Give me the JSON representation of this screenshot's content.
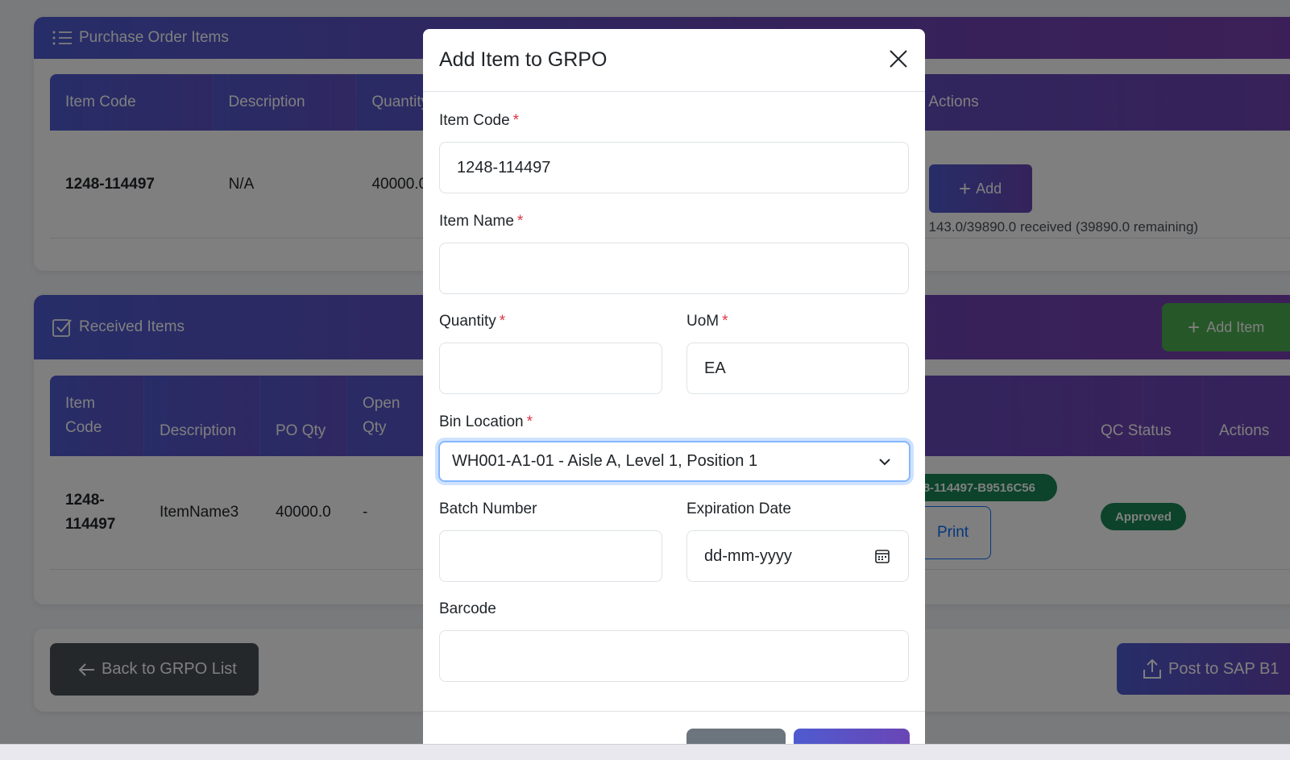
{
  "po_card": {
    "title": "Purchase Order Items",
    "headers": [
      "Item Code",
      "Description",
      "Quantity",
      "Actions"
    ],
    "row": {
      "item_code": "1248-114497",
      "description": "N/A",
      "quantity": "40000.0",
      "add_label": "Add",
      "received_text": "143.0/39890.0 received (39890.0 remaining)"
    }
  },
  "received_card": {
    "title": "Received Items",
    "add_item_label": "Add Item",
    "headers": [
      "Item Code",
      "Description",
      "PO Qty",
      "Open Qty",
      "QC Status",
      "Actions"
    ],
    "header_item_code_line1": "Item",
    "header_item_code_line2": "Code",
    "header_open_qty_line1": "Open",
    "header_open_qty_line2": "Qty",
    "row": {
      "item_code_line1": "1248-",
      "item_code_line2": "114497",
      "description": "ItemName3",
      "po_qty": "40000.0",
      "open_qty": "-",
      "batch_badge": "248-114497-B9516C56",
      "print_label": "Print",
      "qc_status": "Approved"
    }
  },
  "footer": {
    "back_label": "Back to GRPO List",
    "post_label": "Post to SAP B1"
  },
  "modal": {
    "title": "Add Item to GRPO",
    "fields": {
      "item_code": {
        "label": "Item Code",
        "value": "1248-114497"
      },
      "item_name": {
        "label": "Item Name",
        "value": ""
      },
      "quantity": {
        "label": "Quantity",
        "value": ""
      },
      "uom": {
        "label": "UoM",
        "value": "EA"
      },
      "bin_location": {
        "label": "Bin Location",
        "value": "WH001-A1-01 - Aisle A, Level 1, Position 1"
      },
      "batch_number": {
        "label": "Batch Number",
        "value": ""
      },
      "expiration_date": {
        "label": "Expiration Date",
        "placeholder": "dd-mm-yyyy"
      },
      "barcode": {
        "label": "Barcode",
        "value": ""
      }
    },
    "required_mark": "*"
  },
  "colors": {
    "primary_gradient_start": "#4e5bd0",
    "primary_gradient_end": "#6a45b5",
    "success": "#198754",
    "dark_button": "#495057",
    "required": "#dc3545",
    "focus_border": "#86b7fe"
  }
}
